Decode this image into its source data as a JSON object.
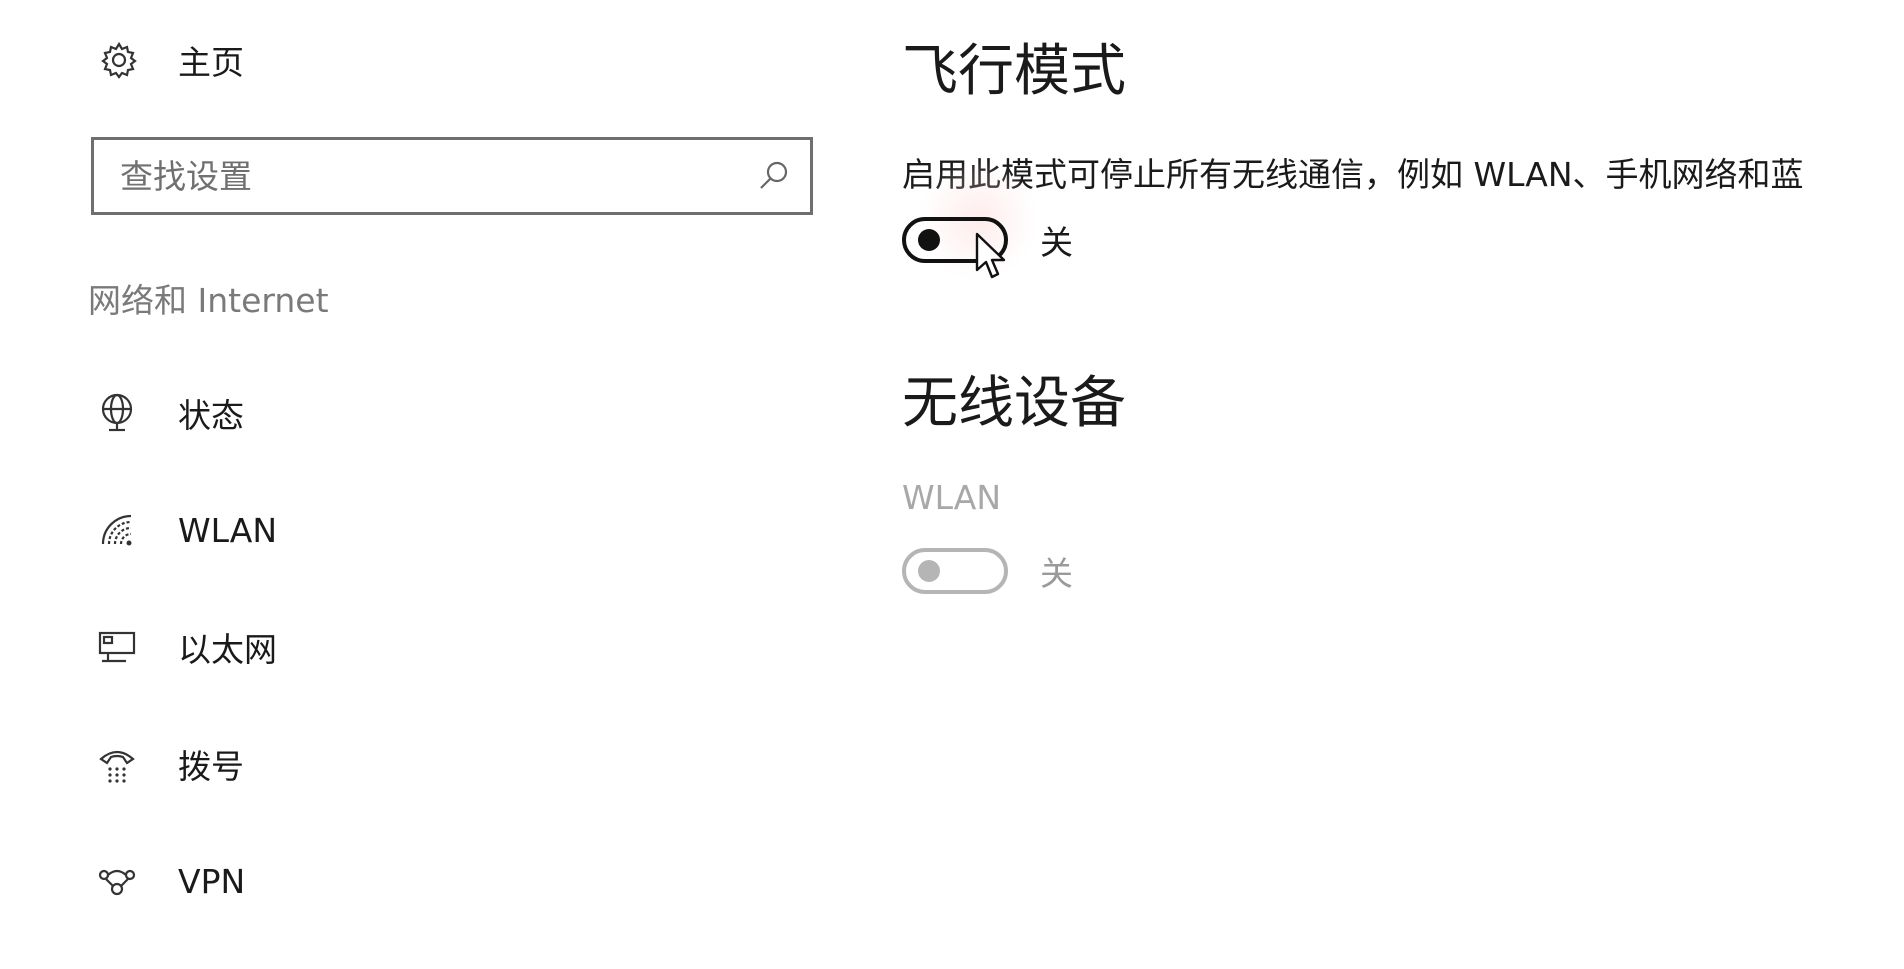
{
  "sidebar": {
    "home": {
      "icon": "gear-icon",
      "label": "主页"
    },
    "search": {
      "placeholder": "查找设置",
      "value": "",
      "icon": "search-icon"
    },
    "section_header": "网络和 Internet",
    "items": [
      {
        "icon": "globe-status-icon",
        "label": "状态"
      },
      {
        "icon": "wifi-icon",
        "label": "WLAN"
      },
      {
        "icon": "ethernet-icon",
        "label": "以太网"
      },
      {
        "icon": "dialup-phone-icon",
        "label": "拨号"
      },
      {
        "icon": "vpn-icon",
        "label": "VPN"
      }
    ]
  },
  "main": {
    "airplane": {
      "title": "飞行模式",
      "description": "启用此模式可停止所有无线通信，例如 WLAN、手机网络和蓝",
      "toggle": {
        "on": false,
        "state_label": "关"
      }
    },
    "wireless": {
      "title": "无线设备",
      "devices": [
        {
          "name": "WLAN",
          "on": false,
          "state_label": "关",
          "enabled": false
        }
      ]
    }
  },
  "colors": {
    "text": "#1a1a1a",
    "muted": "#7a7a7a",
    "disabled": "#b5b5b5",
    "border": "#6f6f6f"
  }
}
